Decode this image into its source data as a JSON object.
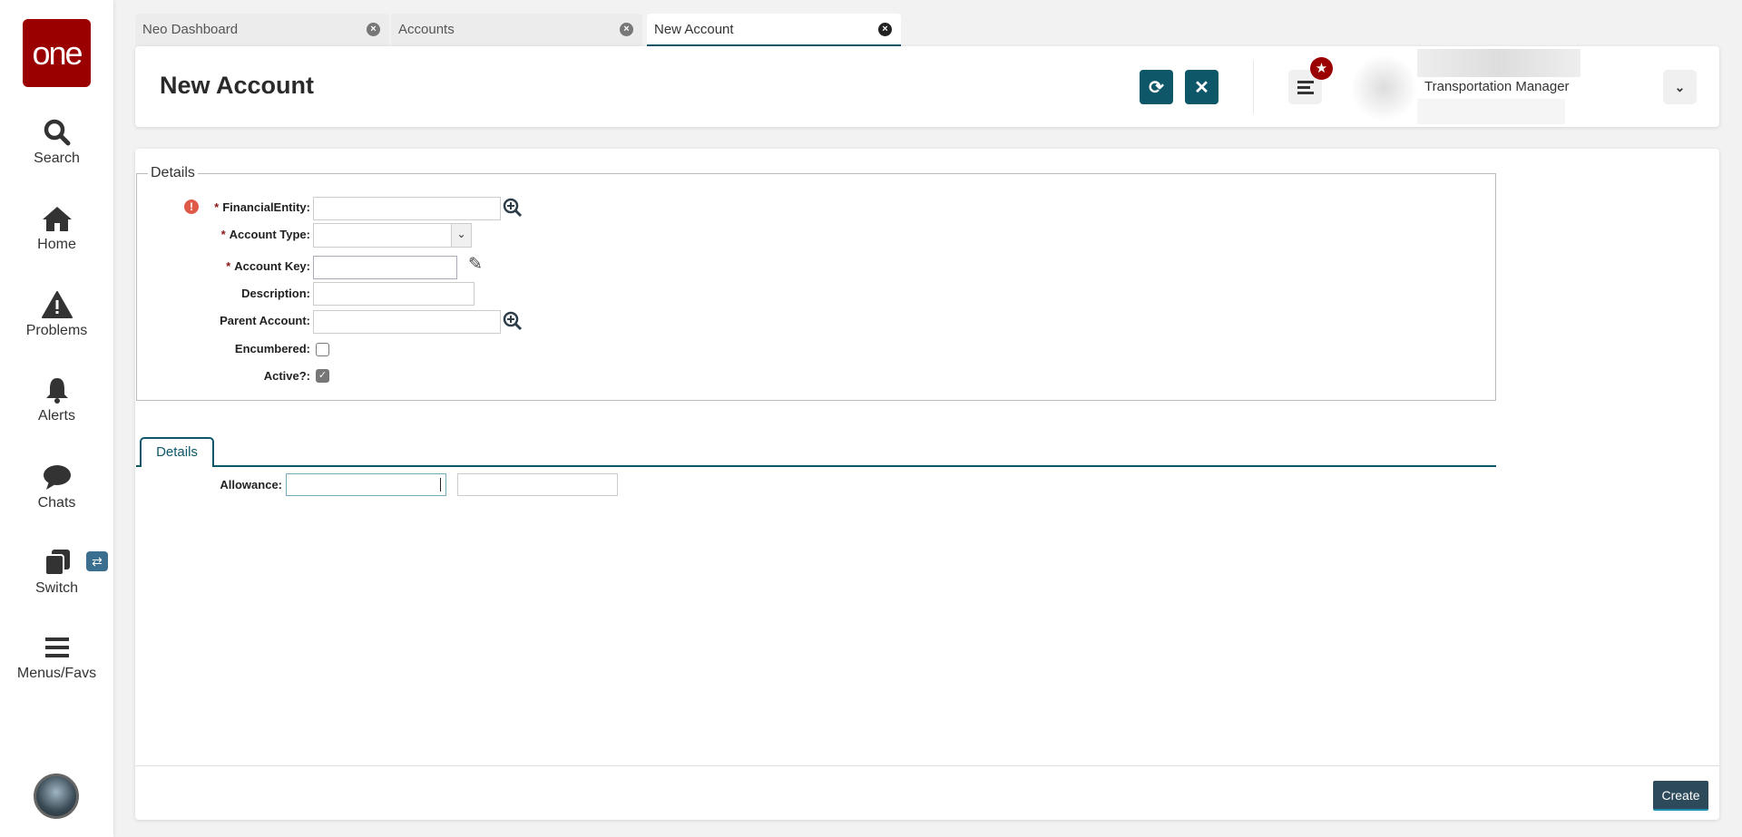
{
  "sidebar": {
    "logo": "one",
    "items": [
      {
        "label": "Search",
        "icon": "search-icon"
      },
      {
        "label": "Home",
        "icon": "home-icon"
      },
      {
        "label": "Problems",
        "icon": "warning-icon"
      },
      {
        "label": "Alerts",
        "icon": "bell-icon"
      },
      {
        "label": "Chats",
        "icon": "chat-icon"
      },
      {
        "label": "Switch",
        "icon": "switch-icon"
      },
      {
        "label": "Menus/Favs",
        "icon": "menu-icon"
      }
    ]
  },
  "tabs": [
    {
      "label": "Neo Dashboard"
    },
    {
      "label": "Accounts"
    },
    {
      "label": "New Account",
      "active": true
    }
  ],
  "header": {
    "title": "New Account",
    "user_role": "Transportation Manager"
  },
  "form": {
    "legend": "Details",
    "fields": {
      "financial_entity": "FinancialEntity:",
      "account_type": "Account Type:",
      "account_key": "Account Key:",
      "description": "Description:",
      "parent_account": "Parent Account:",
      "encumbered": "Encumbered:",
      "active": "Active?:"
    },
    "required_mark": "*",
    "encumbered_checked": false,
    "active_checked": true
  },
  "subtabs": {
    "details": "Details",
    "allowance": "Allowance:"
  },
  "footer": {
    "create": "Create"
  },
  "colors": {
    "accent": "#0d5769",
    "brand": "#9b0000"
  }
}
